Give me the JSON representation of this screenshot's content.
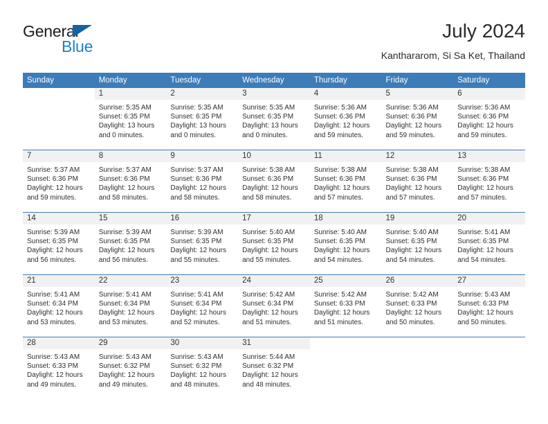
{
  "branding": {
    "name_top": "General",
    "name_bottom": "Blue",
    "triangle_color": "#1464a5",
    "blue_color": "#1d7fc4"
  },
  "header": {
    "month_title": "July 2024",
    "location": "Kanthararom, Si Sa Ket, Thailand"
  },
  "theme": {
    "header_bg": "#3c7cb8",
    "header_text": "#ffffff",
    "daynum_bg": "#f1f1f1",
    "cell_bg": "#ffffff",
    "grid_line": "#3c7cb8"
  },
  "calendar": {
    "weekday_headers": [
      "Sunday",
      "Monday",
      "Tuesday",
      "Wednesday",
      "Thursday",
      "Friday",
      "Saturday"
    ],
    "weeks": [
      [
        {
          "day": "",
          "lines": []
        },
        {
          "day": "1",
          "lines": [
            "Sunrise: 5:35 AM",
            "Sunset: 6:35 PM",
            "Daylight: 13 hours",
            "and 0 minutes."
          ]
        },
        {
          "day": "2",
          "lines": [
            "Sunrise: 5:35 AM",
            "Sunset: 6:35 PM",
            "Daylight: 13 hours",
            "and 0 minutes."
          ]
        },
        {
          "day": "3",
          "lines": [
            "Sunrise: 5:35 AM",
            "Sunset: 6:35 PM",
            "Daylight: 13 hours",
            "and 0 minutes."
          ]
        },
        {
          "day": "4",
          "lines": [
            "Sunrise: 5:36 AM",
            "Sunset: 6:36 PM",
            "Daylight: 12 hours",
            "and 59 minutes."
          ]
        },
        {
          "day": "5",
          "lines": [
            "Sunrise: 5:36 AM",
            "Sunset: 6:36 PM",
            "Daylight: 12 hours",
            "and 59 minutes."
          ]
        },
        {
          "day": "6",
          "lines": [
            "Sunrise: 5:36 AM",
            "Sunset: 6:36 PM",
            "Daylight: 12 hours",
            "and 59 minutes."
          ]
        }
      ],
      [
        {
          "day": "7",
          "lines": [
            "Sunrise: 5:37 AM",
            "Sunset: 6:36 PM",
            "Daylight: 12 hours",
            "and 59 minutes."
          ]
        },
        {
          "day": "8",
          "lines": [
            "Sunrise: 5:37 AM",
            "Sunset: 6:36 PM",
            "Daylight: 12 hours",
            "and 58 minutes."
          ]
        },
        {
          "day": "9",
          "lines": [
            "Sunrise: 5:37 AM",
            "Sunset: 6:36 PM",
            "Daylight: 12 hours",
            "and 58 minutes."
          ]
        },
        {
          "day": "10",
          "lines": [
            "Sunrise: 5:38 AM",
            "Sunset: 6:36 PM",
            "Daylight: 12 hours",
            "and 58 minutes."
          ]
        },
        {
          "day": "11",
          "lines": [
            "Sunrise: 5:38 AM",
            "Sunset: 6:36 PM",
            "Daylight: 12 hours",
            "and 57 minutes."
          ]
        },
        {
          "day": "12",
          "lines": [
            "Sunrise: 5:38 AM",
            "Sunset: 6:36 PM",
            "Daylight: 12 hours",
            "and 57 minutes."
          ]
        },
        {
          "day": "13",
          "lines": [
            "Sunrise: 5:38 AM",
            "Sunset: 6:36 PM",
            "Daylight: 12 hours",
            "and 57 minutes."
          ]
        }
      ],
      [
        {
          "day": "14",
          "lines": [
            "Sunrise: 5:39 AM",
            "Sunset: 6:35 PM",
            "Daylight: 12 hours",
            "and 56 minutes."
          ]
        },
        {
          "day": "15",
          "lines": [
            "Sunrise: 5:39 AM",
            "Sunset: 6:35 PM",
            "Daylight: 12 hours",
            "and 56 minutes."
          ]
        },
        {
          "day": "16",
          "lines": [
            "Sunrise: 5:39 AM",
            "Sunset: 6:35 PM",
            "Daylight: 12 hours",
            "and 55 minutes."
          ]
        },
        {
          "day": "17",
          "lines": [
            "Sunrise: 5:40 AM",
            "Sunset: 6:35 PM",
            "Daylight: 12 hours",
            "and 55 minutes."
          ]
        },
        {
          "day": "18",
          "lines": [
            "Sunrise: 5:40 AM",
            "Sunset: 6:35 PM",
            "Daylight: 12 hours",
            "and 54 minutes."
          ]
        },
        {
          "day": "19",
          "lines": [
            "Sunrise: 5:40 AM",
            "Sunset: 6:35 PM",
            "Daylight: 12 hours",
            "and 54 minutes."
          ]
        },
        {
          "day": "20",
          "lines": [
            "Sunrise: 5:41 AM",
            "Sunset: 6:35 PM",
            "Daylight: 12 hours",
            "and 54 minutes."
          ]
        }
      ],
      [
        {
          "day": "21",
          "lines": [
            "Sunrise: 5:41 AM",
            "Sunset: 6:34 PM",
            "Daylight: 12 hours",
            "and 53 minutes."
          ]
        },
        {
          "day": "22",
          "lines": [
            "Sunrise: 5:41 AM",
            "Sunset: 6:34 PM",
            "Daylight: 12 hours",
            "and 53 minutes."
          ]
        },
        {
          "day": "23",
          "lines": [
            "Sunrise: 5:41 AM",
            "Sunset: 6:34 PM",
            "Daylight: 12 hours",
            "and 52 minutes."
          ]
        },
        {
          "day": "24",
          "lines": [
            "Sunrise: 5:42 AM",
            "Sunset: 6:34 PM",
            "Daylight: 12 hours",
            "and 51 minutes."
          ]
        },
        {
          "day": "25",
          "lines": [
            "Sunrise: 5:42 AM",
            "Sunset: 6:33 PM",
            "Daylight: 12 hours",
            "and 51 minutes."
          ]
        },
        {
          "day": "26",
          "lines": [
            "Sunrise: 5:42 AM",
            "Sunset: 6:33 PM",
            "Daylight: 12 hours",
            "and 50 minutes."
          ]
        },
        {
          "day": "27",
          "lines": [
            "Sunrise: 5:43 AM",
            "Sunset: 6:33 PM",
            "Daylight: 12 hours",
            "and 50 minutes."
          ]
        }
      ],
      [
        {
          "day": "28",
          "lines": [
            "Sunrise: 5:43 AM",
            "Sunset: 6:33 PM",
            "Daylight: 12 hours",
            "and 49 minutes."
          ]
        },
        {
          "day": "29",
          "lines": [
            "Sunrise: 5:43 AM",
            "Sunset: 6:32 PM",
            "Daylight: 12 hours",
            "and 49 minutes."
          ]
        },
        {
          "day": "30",
          "lines": [
            "Sunrise: 5:43 AM",
            "Sunset: 6:32 PM",
            "Daylight: 12 hours",
            "and 48 minutes."
          ]
        },
        {
          "day": "31",
          "lines": [
            "Sunrise: 5:44 AM",
            "Sunset: 6:32 PM",
            "Daylight: 12 hours",
            "and 48 minutes."
          ]
        },
        {
          "day": "",
          "lines": []
        },
        {
          "day": "",
          "lines": []
        },
        {
          "day": "",
          "lines": []
        }
      ]
    ]
  }
}
